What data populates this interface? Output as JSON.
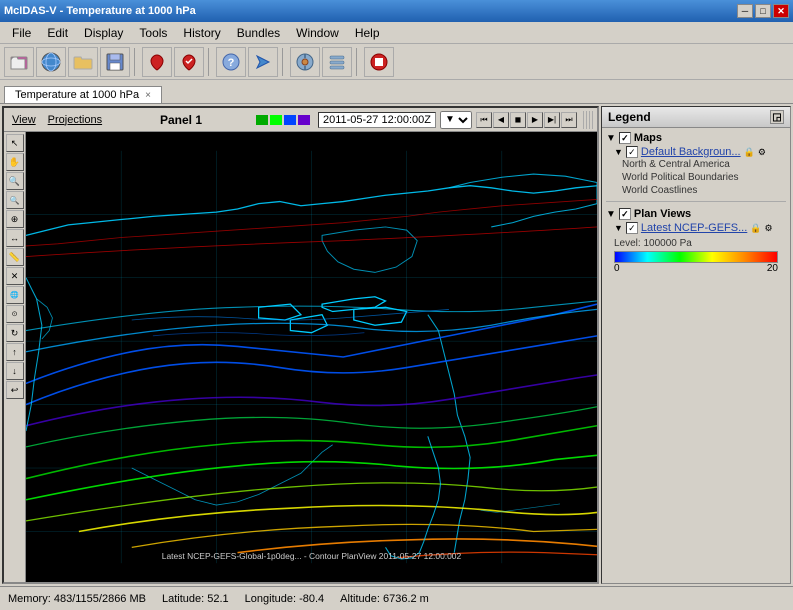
{
  "titleBar": {
    "title": "McIDAS-V - Temperature at 1000 hPa",
    "minimize": "─",
    "maximize": "□",
    "close": "✕"
  },
  "menuBar": {
    "items": [
      "File",
      "Edit",
      "Display",
      "Tools",
      "History",
      "Bundles",
      "Window",
      "Help"
    ]
  },
  "toolbar": {
    "buttons": [
      {
        "name": "open-btn",
        "icon": "📂"
      },
      {
        "name": "save-btn",
        "icon": "💾"
      },
      {
        "name": "print-btn",
        "icon": "🖨"
      },
      {
        "name": "favorite-btn",
        "icon": "❤"
      },
      {
        "name": "capture-btn",
        "icon": "📷"
      },
      {
        "name": "help-btn",
        "icon": "?"
      },
      {
        "name": "arrow-btn",
        "icon": "→"
      },
      {
        "name": "satellite-btn",
        "icon": "⊕"
      },
      {
        "name": "layers-btn",
        "icon": "≡"
      },
      {
        "name": "stop-btn",
        "icon": "⏹"
      }
    ]
  },
  "tab": {
    "label": "Temperature at 1000 hPa",
    "close": "×"
  },
  "mapPanel": {
    "viewLabel": "View",
    "projectionsLabel": "Projections",
    "panelLabel": "Panel 1",
    "timeDisplay": "2011-05-27 12:00:00Z",
    "colorBars": [
      "#00aa00",
      "#00ff00",
      "#0000ff",
      "#8800ff"
    ]
  },
  "playback": {
    "buttons": [
      "⏮",
      "⏪",
      "⏴",
      "⏵",
      "⏩",
      "⏭"
    ]
  },
  "legend": {
    "title": "Legend",
    "sections": [
      {
        "label": "Maps",
        "items": [
          {
            "label": "Default Backgroun...",
            "link": true,
            "locked": true,
            "subitems": [
              "North & Central America",
              "World Political Boundaries",
              "World Coastlines"
            ]
          }
        ]
      },
      {
        "label": "Plan Views",
        "items": [
          {
            "label": "Latest NCEP-GEFS...",
            "link": true,
            "locked": true,
            "subitems": []
          }
        ]
      }
    ],
    "colorScale": {
      "levelLabel": "Level: 100000 Pa",
      "min": "0",
      "max": "20"
    }
  },
  "statusBar": {
    "memory": "Memory: 483/1155/2866 MB",
    "latitude": "Latitude: 52.1",
    "longitude": "Longitude: -80.4",
    "altitude": "Altitude: 6736.2 m"
  },
  "mapCaption": "Latest NCEP-GEFS-Global-1p0deg... - Contour PlanView 2011-05-27 12:00:002",
  "sidebarIcons": [
    "↖",
    "✋",
    "🔍",
    "🔍",
    "⊕",
    "↔",
    "📏",
    "🗑",
    "⊙",
    "⊙",
    "⊙",
    "✏",
    "↩"
  ]
}
